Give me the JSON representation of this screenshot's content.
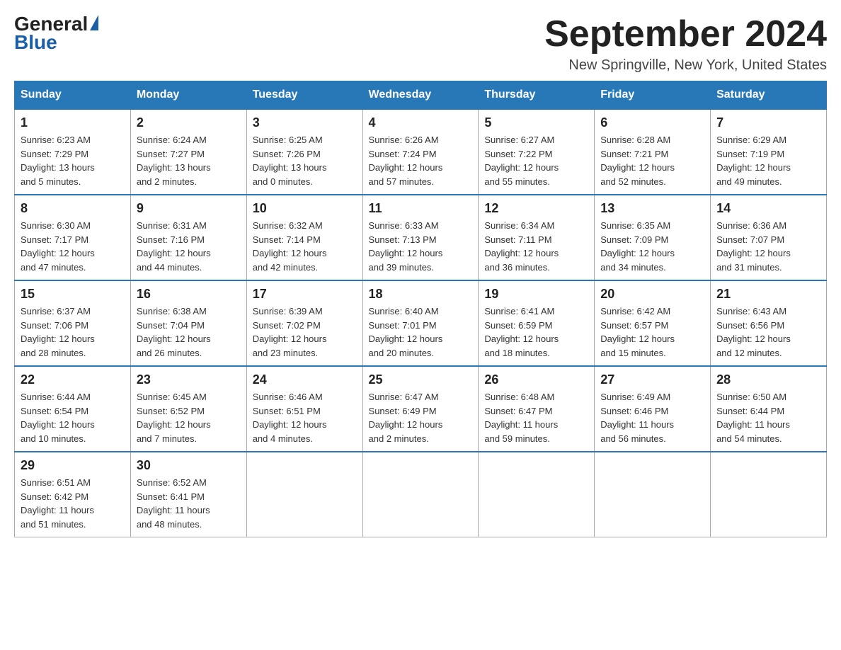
{
  "header": {
    "logo_top": "General",
    "logo_bottom": "Blue",
    "calendar_title": "September 2024",
    "calendar_subtitle": "New Springville, New York, United States"
  },
  "days_of_week": [
    "Sunday",
    "Monday",
    "Tuesday",
    "Wednesday",
    "Thursday",
    "Friday",
    "Saturday"
  ],
  "weeks": [
    [
      {
        "day": "1",
        "sunrise": "6:23 AM",
        "sunset": "7:29 PM",
        "daylight": "13 hours and 5 minutes."
      },
      {
        "day": "2",
        "sunrise": "6:24 AM",
        "sunset": "7:27 PM",
        "daylight": "13 hours and 2 minutes."
      },
      {
        "day": "3",
        "sunrise": "6:25 AM",
        "sunset": "7:26 PM",
        "daylight": "13 hours and 0 minutes."
      },
      {
        "day": "4",
        "sunrise": "6:26 AM",
        "sunset": "7:24 PM",
        "daylight": "12 hours and 57 minutes."
      },
      {
        "day": "5",
        "sunrise": "6:27 AM",
        "sunset": "7:22 PM",
        "daylight": "12 hours and 55 minutes."
      },
      {
        "day": "6",
        "sunrise": "6:28 AM",
        "sunset": "7:21 PM",
        "daylight": "12 hours and 52 minutes."
      },
      {
        "day": "7",
        "sunrise": "6:29 AM",
        "sunset": "7:19 PM",
        "daylight": "12 hours and 49 minutes."
      }
    ],
    [
      {
        "day": "8",
        "sunrise": "6:30 AM",
        "sunset": "7:17 PM",
        "daylight": "12 hours and 47 minutes."
      },
      {
        "day": "9",
        "sunrise": "6:31 AM",
        "sunset": "7:16 PM",
        "daylight": "12 hours and 44 minutes."
      },
      {
        "day": "10",
        "sunrise": "6:32 AM",
        "sunset": "7:14 PM",
        "daylight": "12 hours and 42 minutes."
      },
      {
        "day": "11",
        "sunrise": "6:33 AM",
        "sunset": "7:13 PM",
        "daylight": "12 hours and 39 minutes."
      },
      {
        "day": "12",
        "sunrise": "6:34 AM",
        "sunset": "7:11 PM",
        "daylight": "12 hours and 36 minutes."
      },
      {
        "day": "13",
        "sunrise": "6:35 AM",
        "sunset": "7:09 PM",
        "daylight": "12 hours and 34 minutes."
      },
      {
        "day": "14",
        "sunrise": "6:36 AM",
        "sunset": "7:07 PM",
        "daylight": "12 hours and 31 minutes."
      }
    ],
    [
      {
        "day": "15",
        "sunrise": "6:37 AM",
        "sunset": "7:06 PM",
        "daylight": "12 hours and 28 minutes."
      },
      {
        "day": "16",
        "sunrise": "6:38 AM",
        "sunset": "7:04 PM",
        "daylight": "12 hours and 26 minutes."
      },
      {
        "day": "17",
        "sunrise": "6:39 AM",
        "sunset": "7:02 PM",
        "daylight": "12 hours and 23 minutes."
      },
      {
        "day": "18",
        "sunrise": "6:40 AM",
        "sunset": "7:01 PM",
        "daylight": "12 hours and 20 minutes."
      },
      {
        "day": "19",
        "sunrise": "6:41 AM",
        "sunset": "6:59 PM",
        "daylight": "12 hours and 18 minutes."
      },
      {
        "day": "20",
        "sunrise": "6:42 AM",
        "sunset": "6:57 PM",
        "daylight": "12 hours and 15 minutes."
      },
      {
        "day": "21",
        "sunrise": "6:43 AM",
        "sunset": "6:56 PM",
        "daylight": "12 hours and 12 minutes."
      }
    ],
    [
      {
        "day": "22",
        "sunrise": "6:44 AM",
        "sunset": "6:54 PM",
        "daylight": "12 hours and 10 minutes."
      },
      {
        "day": "23",
        "sunrise": "6:45 AM",
        "sunset": "6:52 PM",
        "daylight": "12 hours and 7 minutes."
      },
      {
        "day": "24",
        "sunrise": "6:46 AM",
        "sunset": "6:51 PM",
        "daylight": "12 hours and 4 minutes."
      },
      {
        "day": "25",
        "sunrise": "6:47 AM",
        "sunset": "6:49 PM",
        "daylight": "12 hours and 2 minutes."
      },
      {
        "day": "26",
        "sunrise": "6:48 AM",
        "sunset": "6:47 PM",
        "daylight": "11 hours and 59 minutes."
      },
      {
        "day": "27",
        "sunrise": "6:49 AM",
        "sunset": "6:46 PM",
        "daylight": "11 hours and 56 minutes."
      },
      {
        "day": "28",
        "sunrise": "6:50 AM",
        "sunset": "6:44 PM",
        "daylight": "11 hours and 54 minutes."
      }
    ],
    [
      {
        "day": "29",
        "sunrise": "6:51 AM",
        "sunset": "6:42 PM",
        "daylight": "11 hours and 51 minutes."
      },
      {
        "day": "30",
        "sunrise": "6:52 AM",
        "sunset": "6:41 PM",
        "daylight": "11 hours and 48 minutes."
      },
      null,
      null,
      null,
      null,
      null
    ]
  ],
  "labels": {
    "sunrise": "Sunrise:",
    "sunset": "Sunset:",
    "daylight": "Daylight:"
  }
}
